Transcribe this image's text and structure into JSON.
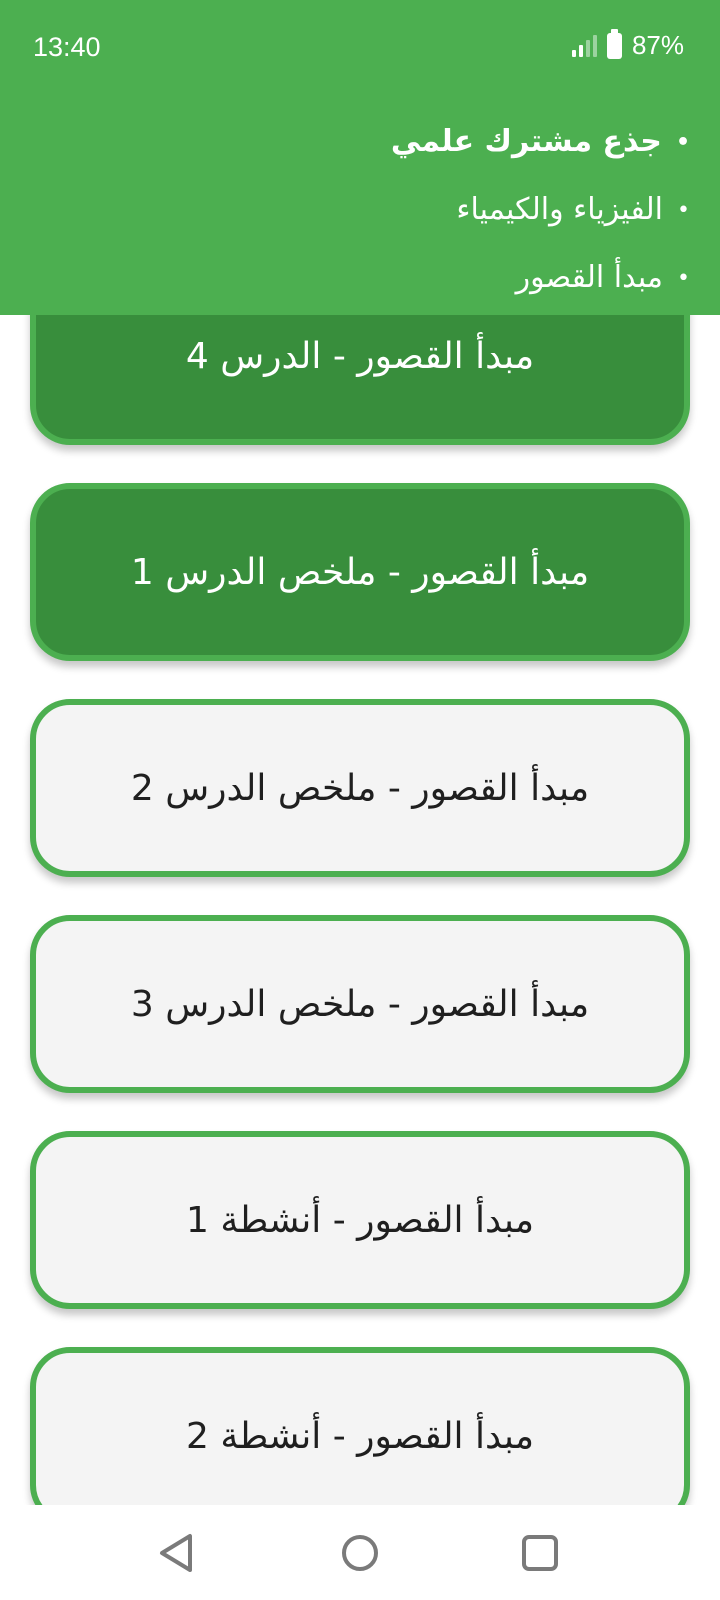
{
  "status_bar": {
    "time": "13:40",
    "battery": "87%",
    "icons": [
      "signal-icon",
      "battery-icon"
    ]
  },
  "breadcrumb": {
    "items": [
      "جذع مشترك علمي",
      "الفيزياء والكيمياء",
      "مبدأ القصور"
    ]
  },
  "lessons": [
    "مبدأ القصور - الدرس 4",
    "مبدأ القصور - ملخص الدرس 1",
    "مبدأ القصور - ملخص الدرس 2",
    "مبدأ القصور - ملخص الدرس 3",
    "مبدأ القصور - أنشطة 1",
    "مبدأ القصور - أنشطة 2"
  ],
  "nav_bar": {
    "icons": [
      "back-icon",
      "home-icon",
      "recents-icon"
    ]
  },
  "colors": {
    "header": "#4caf50",
    "active_button": "#388e3c",
    "inactive_button": "#f4f4f4",
    "border": "#4caf50"
  }
}
